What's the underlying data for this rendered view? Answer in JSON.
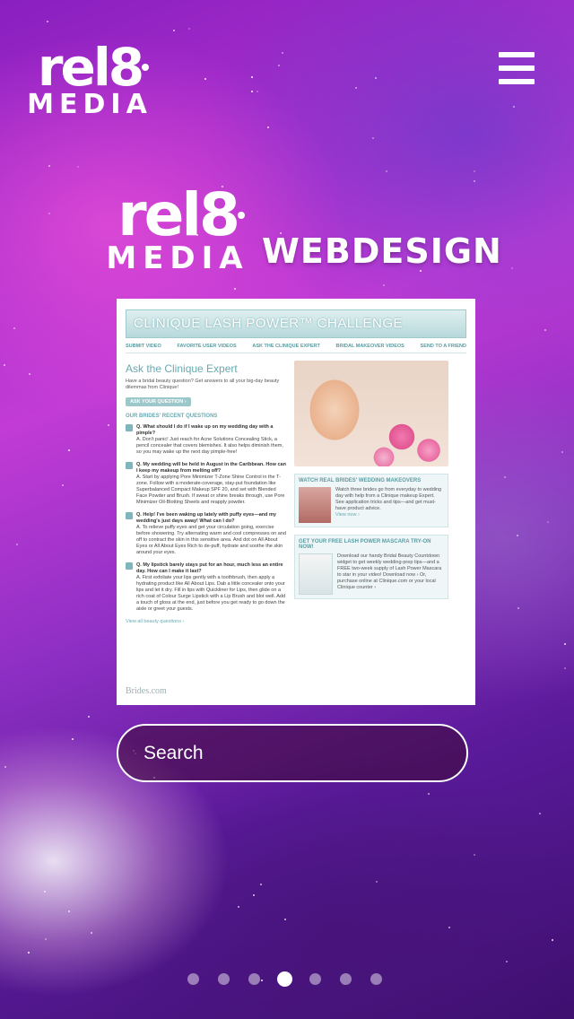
{
  "brand": {
    "logo_main": "rel8",
    "logo_sub": "MEDIA"
  },
  "header": {
    "menu_icon": "hamburger-icon"
  },
  "hero": {
    "logo_main": "rel8",
    "logo_sub": "MEDIA",
    "headline": "WEBDESIGN"
  },
  "preview": {
    "title": "CLINIQUE  LASH POWER™ CHALLENGE",
    "nav": [
      "SUBMIT VIDEO",
      "FAVORITE USER VIDEOS",
      "ASK THE CLINIQUE EXPERT",
      "BRIDAL MAKEOVER VIDEOS",
      "SEND TO A FRIEND"
    ],
    "section_title": "Ask the Clinique Expert",
    "intro": "Have a bridal beauty question? Get answers to all your big-day beauty dilemmas from Clinique!",
    "ask_button": "ASK YOUR QUESTION ›",
    "questions_header": "OUR BRIDES' RECENT QUESTIONS",
    "questions": [
      {
        "q": "Q. What should I do if I wake up on my wedding day with a pimple?",
        "a": "A. Don't panic! Just reach for Acne Solutions Concealing Stick, a pencil concealer that covers blemishes. It also helps diminish them, so you may wake up the next day pimple-free!"
      },
      {
        "q": "Q. My wedding will be held in August in the Caribbean. How can I keep my makeup from melting off?",
        "a": "A. Start by applying Pore Minimizer T-Zone Shine Control in the T-zone. Follow with a moderate-coverage, stay-put foundation like Superbalanced Compact Makeup SPF 20, and set with Blended Face Powder and Brush. If sweat or shine breaks through, use Pore Minimizer Oil-Blotting Sheets and reapply powder."
      },
      {
        "q": "Q. Help! I've been waking up lately with puffy eyes—and my wedding's just days away! What can I do?",
        "a": "A. To relieve puffy eyes and get your circulation going, exercise before showering. Try alternating warm and cool compresses on and off to contract the skin in this sensitive area. And dot on All About Eyes or All About Eyes Rich to de-puff, hydrate and soothe the skin around your eyes."
      },
      {
        "q": "Q. My lipstick barely stays put for an hour, much less an entire day. How can I make it last?",
        "a": "A. First exfoliate your lips gently with a toothbrush, then apply a hydrating product like All About Lips. Dab a little concealer onto your lips and let it dry. Fill in lips with Quickliner for Lips, then glide on a rich coat of Colour Surge Lipstick with a Lip Brush and blot well. Add a touch of gloss at the end, just before you get ready to go down the aisle or greet your guests."
      }
    ],
    "view_all": "View all beauty questions ›",
    "box1_title": "WATCH REAL BRIDES' WEDDING MAKEOVERS",
    "box1_text": "Watch three brides go from everyday to wedding day with help from a Clinique makeup Expert. See application tricks and tips—and get must-have product advice.",
    "box1_link": "View now ›",
    "box2_title": "GET YOUR FREE LASH POWER MASCARA TRY-ON NOW!",
    "box2_text": "Download our handy Bridal Beauty Countdown widget to get weekly wedding-prep tips—and a FREE two-week supply of Lash Power Mascara to star in your video! Download now › Or, purchase online at Clinique.com or your local Clinique counter ›",
    "footer": "Brides.com"
  },
  "search": {
    "label": "Search"
  },
  "pagination": {
    "count": 7,
    "active_index": 3
  }
}
